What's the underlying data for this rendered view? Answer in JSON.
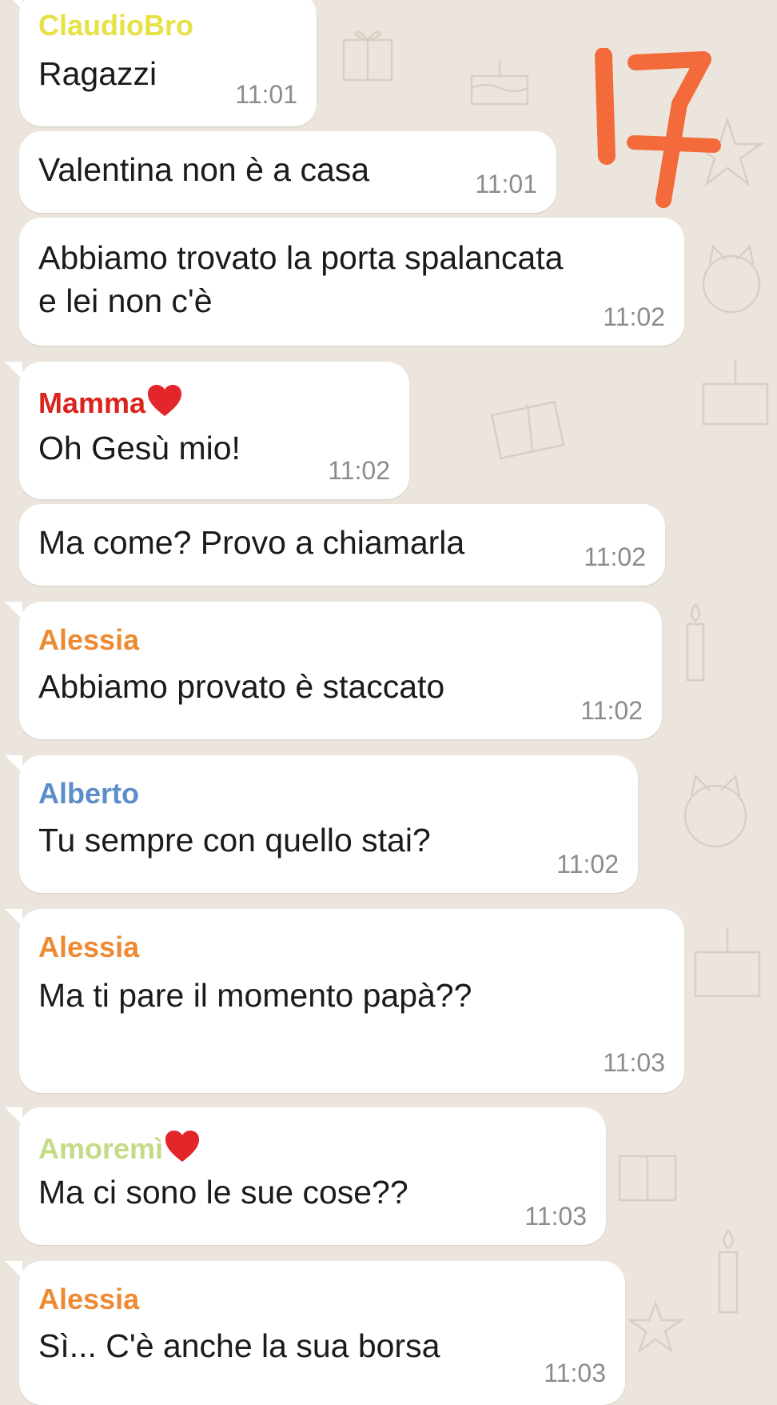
{
  "messages": [
    {
      "sender": "ClaudioBro",
      "sender_color": "#e6e145",
      "lines": [
        "Ragazzi"
      ],
      "time": "11:01"
    },
    {
      "sender": "",
      "lines": [
        "Valentina non è a casa"
      ],
      "time": "11:01"
    },
    {
      "sender": "",
      "lines": [
        "Abbiamo trovato la porta spalancata",
        "e lei non c'è"
      ],
      "time": "11:02"
    },
    {
      "sender": "Mamma",
      "sender_color": "#d9251d",
      "sender_icon": "heart-icon",
      "lines": [
        "Oh Gesù mio!"
      ],
      "time": "11:02"
    },
    {
      "sender": "",
      "lines": [
        "Ma come? Provo a chiamarla"
      ],
      "time": "11:02"
    },
    {
      "sender": "Alessia",
      "sender_color": "#ee8a33",
      "lines": [
        "Abbiamo provato è staccato"
      ],
      "time": "11:02"
    },
    {
      "sender": "Alberto",
      "sender_color": "#5b8ec9",
      "lines": [
        "Tu sempre con quello stai?"
      ],
      "time": "11:02"
    },
    {
      "sender": "Alessia",
      "sender_color": "#ee8a33",
      "lines": [
        "Ma ti pare il momento papà??"
      ],
      "time": "11:03"
    },
    {
      "sender": "Amoremì",
      "sender_color": "#c3dc85",
      "sender_icon": "heart-icon",
      "lines": [
        "Ma ci sono le sue cose??"
      ],
      "time": "11:03"
    },
    {
      "sender": "Alessia",
      "sender_color": "#ee8a33",
      "lines": [
        "Sì... C'è anche la sua borsa"
      ],
      "time": "11:03"
    }
  ],
  "annotation": {
    "text": "17",
    "color": "#f36b3a"
  },
  "colors": {
    "background": "#ece5dd",
    "bubble": "#ffffff",
    "time": "#8c8c8c"
  }
}
